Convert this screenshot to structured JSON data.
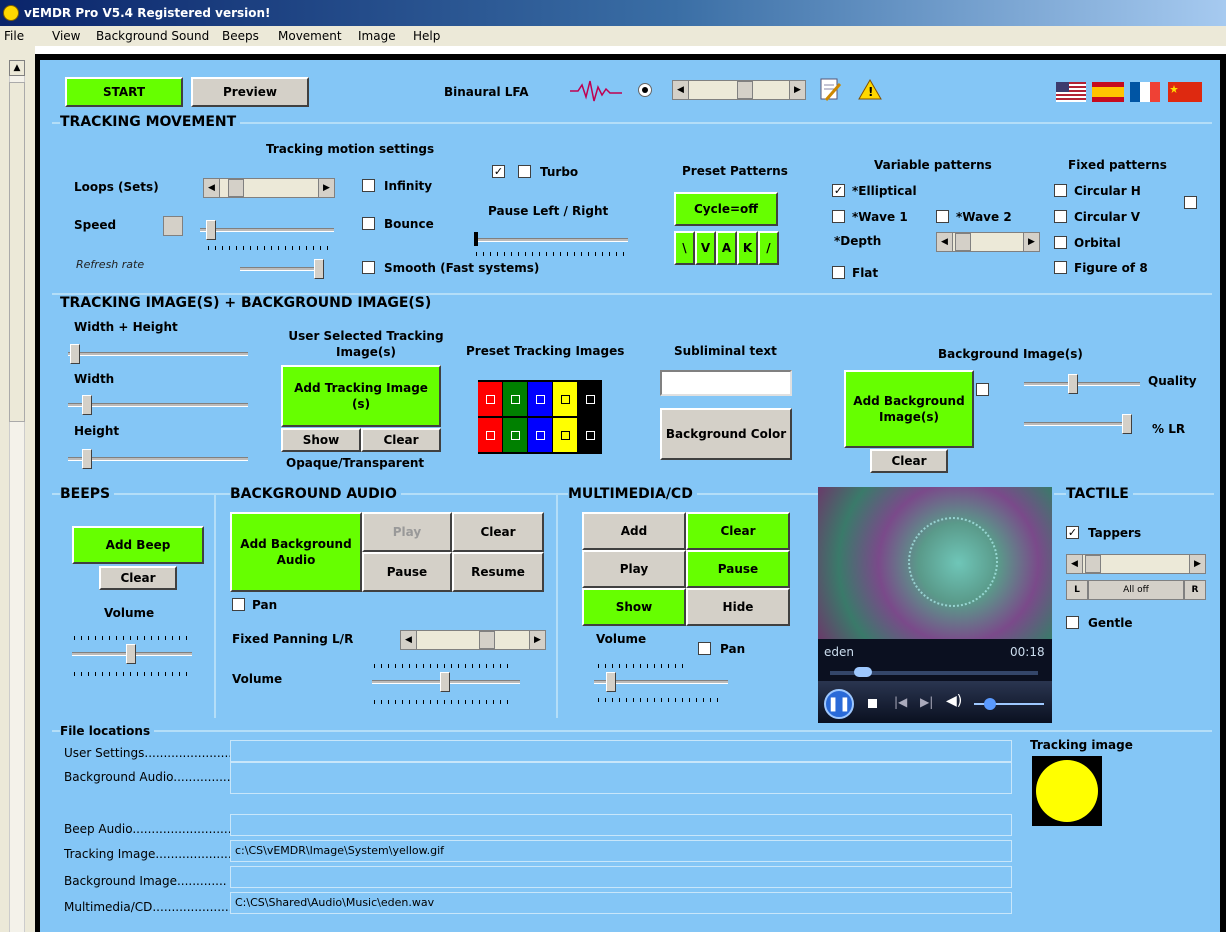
{
  "window": {
    "title": "vEMDR Pro V5.4 Registered version!"
  },
  "menu": [
    "File",
    "View",
    "Background Sound",
    "Beeps",
    "Movement",
    "Image",
    "Help"
  ],
  "toolbar": {
    "start": "START",
    "preview": "Preview",
    "binaural_label": "Binaural LFA"
  },
  "tracking_movement": {
    "section_title": "TRACKING MOVEMENT",
    "motion_heading": "Tracking motion settings",
    "loops": "Loops (Sets)",
    "speed": "Speed",
    "refresh": "Refresh rate",
    "infinity": "Infinity",
    "bounce": "Bounce",
    "smooth": "Smooth (Fast systems)",
    "turbo": "Turbo",
    "turbo_check1": true,
    "turbo_check2": false,
    "pause_lr": "Pause Left / Right",
    "preset_heading": "Preset Patterns",
    "cycle": "Cycle=off",
    "pattern_buttons": [
      "\\",
      "V",
      "A",
      "K",
      "/"
    ],
    "variable_heading": "Variable patterns",
    "elliptical": "*Elliptical",
    "elliptical_checked": true,
    "wave1": "*Wave 1",
    "wave2": "*Wave 2",
    "depth": "*Depth",
    "flat": "Flat",
    "fixed_heading": "Fixed patterns",
    "circular_h": "Circular H",
    "circular_v": "Circular V",
    "orbital": "Orbital",
    "figure8": "Figure of 8"
  },
  "tracking_images": {
    "section_title": "TRACKING IMAGE(S) + BACKGROUND IMAGE(S)",
    "width_height": "Width + Height",
    "width": "Width",
    "height": "Height",
    "user_selected": "User Selected Tracking Image(s)",
    "add_tracking": "Add Tracking Image (s)",
    "show": "Show",
    "clear": "Clear",
    "opaque": "Opaque/Transparent",
    "preset_images": "Preset Tracking Images",
    "preset_colors": [
      "#ff0000",
      "#008000",
      "#0000ff",
      "#ffff00",
      "#000000"
    ],
    "subliminal": "Subliminal text",
    "subliminal_value": "",
    "bg_color": "Background Color",
    "bg_images": "Background Image(s)",
    "add_bg": "Add Background Image(s)",
    "bg_clear": "Clear",
    "quality": "Quality",
    "lr": "% LR"
  },
  "beeps": {
    "section_title": "BEEPS",
    "add": "Add Beep",
    "clear": "Clear",
    "volume": "Volume"
  },
  "bg_audio": {
    "section_title": "BACKGROUND AUDIO",
    "add": "Add Background Audio",
    "play": "Play",
    "clear": "Clear",
    "pause": "Pause",
    "resume": "Resume",
    "pan": "Pan",
    "fixed_panning": "Fixed Panning L/R",
    "volume": "Volume"
  },
  "multimedia": {
    "section_title": "MULTIMEDIA/CD",
    "add": "Add",
    "clear": "Clear",
    "play": "Play",
    "pause": "Pause",
    "show": "Show",
    "hide": "Hide",
    "volume": "Volume",
    "pan": "Pan"
  },
  "player": {
    "track": "eden",
    "time": "00:18"
  },
  "tactile": {
    "section_title": "TACTILE",
    "tappers": "Tappers",
    "tappers_checked": true,
    "l": "L",
    "all_off": "All off",
    "r": "R",
    "gentle": "Gentle"
  },
  "files": {
    "section_title": "File locations",
    "user_settings": "User Settings........................",
    "user_settings_value": "",
    "bg_audio": "Background Audio...............",
    "bg_audio_value": "",
    "beep_audio": "Beep Audio..........................",
    "beep_audio_value": "",
    "tracking_image": "Tracking Image.....................",
    "tracking_image_value": "c:\\CS\\vEMDR\\Image\\System\\yellow.gif",
    "bg_image": "Background Image.............",
    "bg_image_value": "",
    "multimedia": "Multimedia/CD.....................",
    "multimedia_value": "C:\\CS\\Shared\\Audio\\Music\\eden.wav",
    "tracking_preview_label": "Tracking image"
  },
  "colors": {
    "panel": "#84c6f6",
    "green_button": "#66ff00",
    "grey_button": "#d4d0c8",
    "tracking_preview": "#ffff00"
  }
}
